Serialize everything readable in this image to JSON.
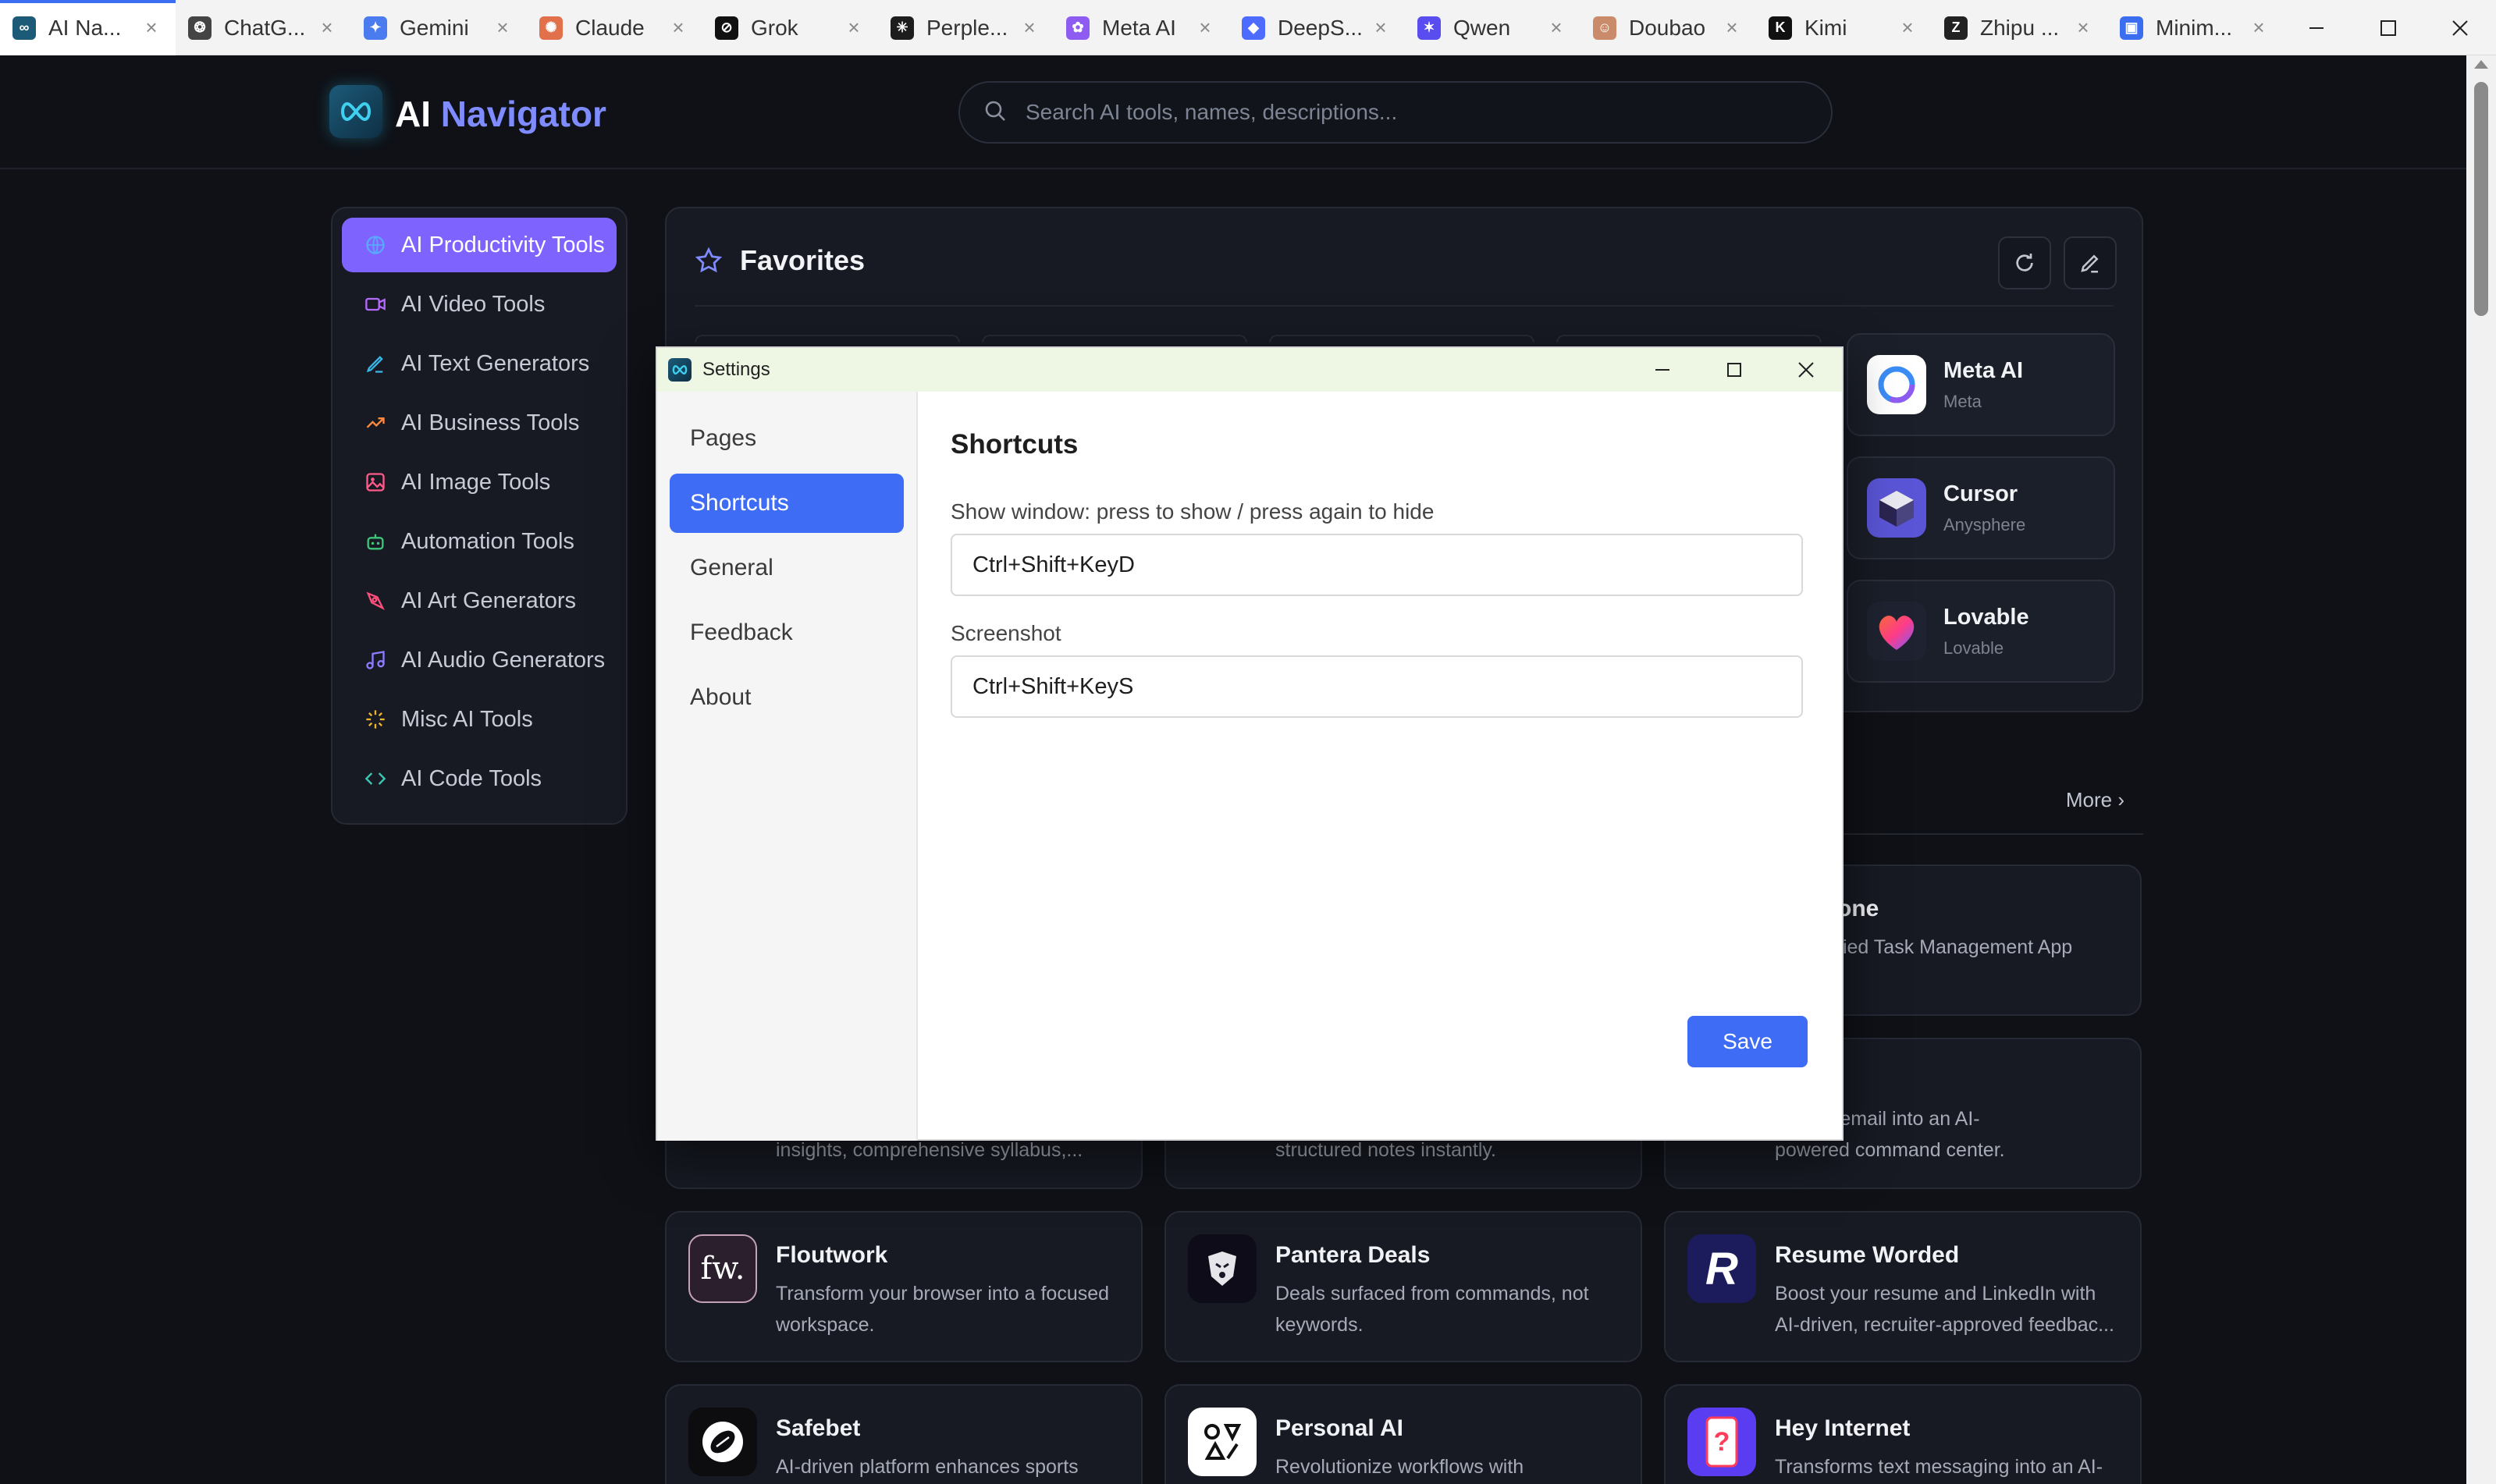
{
  "tabs": [
    {
      "title": "AI Na...",
      "icon": "ai-navigator-icon",
      "color": "#1c5a78",
      "glyph": "∞",
      "active": true
    },
    {
      "title": "ChatG...",
      "icon": "chatgpt-icon",
      "color": "#444444",
      "glyph": "❂",
      "active": false
    },
    {
      "title": "Gemini",
      "icon": "gemini-icon",
      "color": "#4a7cf0",
      "glyph": "✦",
      "active": false
    },
    {
      "title": "Claude",
      "icon": "claude-icon",
      "color": "#e2704a",
      "glyph": "✺",
      "active": false
    },
    {
      "title": "Grok",
      "icon": "grok-icon",
      "color": "#111111",
      "glyph": "⊘",
      "active": false
    },
    {
      "title": "Perple...",
      "icon": "perplexity-icon",
      "color": "#1d1d1d",
      "glyph": "✳",
      "active": false
    },
    {
      "title": "Meta AI",
      "icon": "meta-ai-icon",
      "color": "#8f5cf2",
      "glyph": "✿",
      "active": false
    },
    {
      "title": "DeepS...",
      "icon": "deepseek-icon",
      "color": "#4d6bfe",
      "glyph": "◆",
      "active": false
    },
    {
      "title": "Qwen",
      "icon": "qwen-icon",
      "color": "#5a4df0",
      "glyph": "✶",
      "active": false
    },
    {
      "title": "Doubao",
      "icon": "doubao-icon",
      "color": "#c98b6a",
      "glyph": "☺",
      "active": false
    },
    {
      "title": "Kimi",
      "icon": "kimi-icon",
      "color": "#111111",
      "glyph": "K",
      "active": false
    },
    {
      "title": "Zhipu ...",
      "icon": "zhipu-icon",
      "color": "#222222",
      "glyph": "Z",
      "active": false
    },
    {
      "title": "Minim...",
      "icon": "minimax-icon",
      "color": "#3a6df0",
      "glyph": "▣",
      "active": false
    }
  ],
  "tab_close_glyph": "×",
  "header": {
    "brand_part1": "AI",
    "brand_part2": "Navigator",
    "search_placeholder": "Search AI tools, names, descriptions..."
  },
  "sidebar": {
    "items": [
      {
        "label": "AI Productivity Tools",
        "icon": "globe-icon",
        "color": "#4fa3ff",
        "active": true
      },
      {
        "label": "AI Video Tools",
        "icon": "video-icon",
        "color": "#b469ff",
        "active": false
      },
      {
        "label": "AI Text Generators",
        "icon": "pen-icon",
        "color": "#38b6e8",
        "active": false
      },
      {
        "label": "AI Business Tools",
        "icon": "trend-up-icon",
        "color": "#ff8a3d",
        "active": false
      },
      {
        "label": "AI Image Tools",
        "icon": "image-icon",
        "color": "#ff5a8a",
        "active": false
      },
      {
        "label": "Automation Tools",
        "icon": "robot-icon",
        "color": "#3ec77a",
        "active": false
      },
      {
        "label": "AI Art Generators",
        "icon": "brush-icon",
        "color": "#ff4f7a",
        "active": false
      },
      {
        "label": "AI Audio Generators",
        "icon": "music-icon",
        "color": "#8f7bff",
        "active": false
      },
      {
        "label": "Misc AI Tools",
        "icon": "sparkle-icon",
        "color": "#f0b429",
        "active": false
      },
      {
        "label": "AI Code Tools",
        "icon": "code-icon",
        "color": "#3ec7b5",
        "active": false
      }
    ]
  },
  "favorites": {
    "title": "Favorites",
    "cards": [
      {
        "name": "Meta AI",
        "maker": "Meta",
        "icon": "meta-ai-logo-icon"
      },
      {
        "name": "Cursor",
        "maker": "Anysphere",
        "icon": "cursor-logo-icon"
      },
      {
        "name": "Lovable",
        "maker": "Lovable",
        "icon": "lovable-logo-icon"
      }
    ]
  },
  "more_link": "More ›",
  "tools": [
    {
      "name": "",
      "desc": "one",
      "partial": "title"
    },
    {
      "name": "",
      "desc": "fied Task Management App",
      "partial": "desc1"
    },
    {
      "desc_left": "insights, comprehensive syllabus,...",
      "desc_mid": "structured notes instantly.",
      "desc_right_1": "m your email into an AI-",
      "desc_right_2": "powered command center."
    },
    {
      "name": "Floutwork",
      "desc": "Transform your browser into a focused workspace.",
      "icon": "floutwork-logo-icon",
      "glyph": "fw."
    },
    {
      "name": "Pantera Deals",
      "desc": "Deals surfaced from commands, not keywords.",
      "icon": "pantera-logo-icon",
      "glyph": "◈"
    },
    {
      "name": "Resume Worded",
      "desc": "Boost your resume and LinkedIn with AI-driven, recruiter-approved feedbac...",
      "icon": "resume-worded-logo-icon",
      "glyph": "R"
    },
    {
      "name": "Safebet",
      "desc": "AI-driven platform enhances sports",
      "icon": "safebet-logo-icon",
      "glyph": "🏈"
    },
    {
      "name": "Personal AI",
      "desc": "Revolutionize workflows with",
      "icon": "personal-ai-logo-icon",
      "glyph": "◎"
    },
    {
      "name": "Hey Internet",
      "desc": "Transforms text messaging into an AI-",
      "icon": "hey-internet-logo-icon",
      "glyph": "?"
    }
  ],
  "dialog": {
    "title": "Settings",
    "nav": [
      {
        "label": "Pages",
        "active": false
      },
      {
        "label": "Shortcuts",
        "active": true
      },
      {
        "label": "General",
        "active": false
      },
      {
        "label": "Feedback",
        "active": false
      },
      {
        "label": "About",
        "active": false
      }
    ],
    "heading": "Shortcuts",
    "show_window_label": "Show window: press to show / press again to hide",
    "show_window_value": "Ctrl+Shift+KeyD",
    "screenshot_label": "Screenshot",
    "screenshot_value": "Ctrl+Shift+KeyS",
    "save_label": "Save"
  },
  "colors": {
    "accent": "#3f6cf5",
    "sidebar_active": "#7f63ff",
    "brand_highlight": "#7f8cff",
    "background": "#0f1117"
  }
}
